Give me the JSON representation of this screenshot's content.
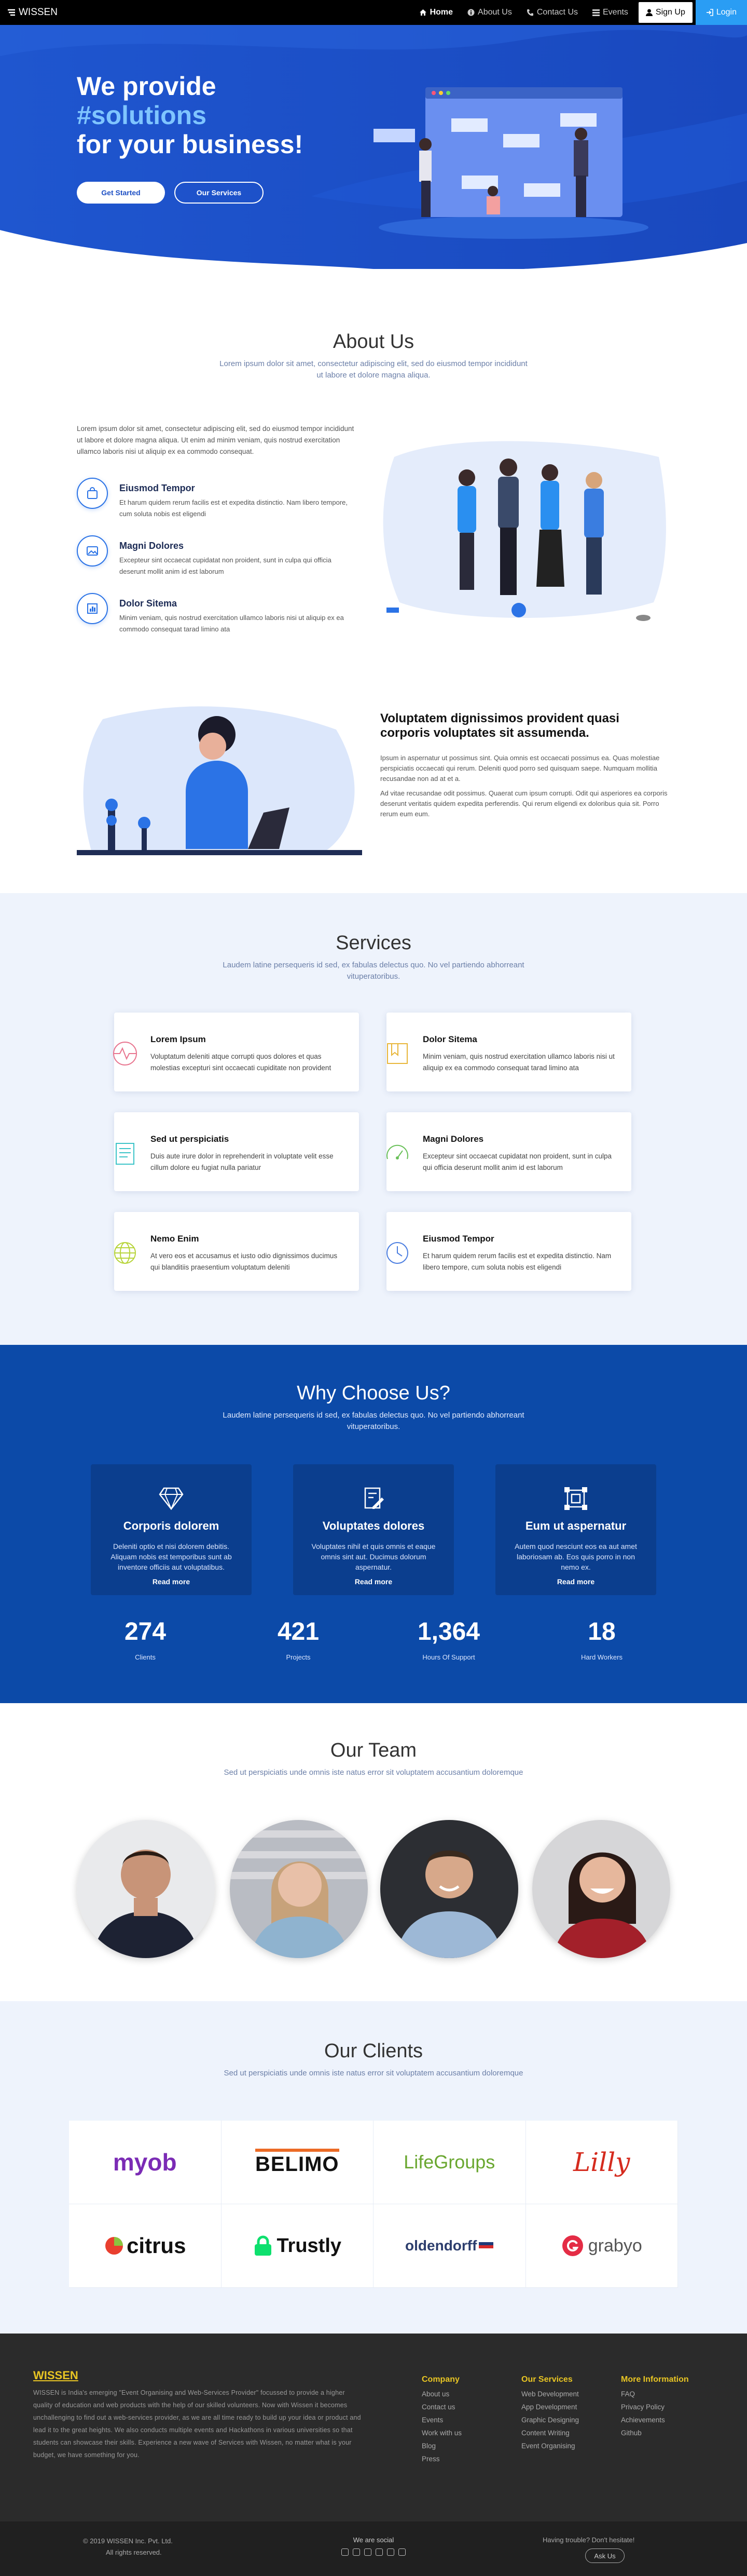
{
  "nav": {
    "brand": "WISSEN",
    "links": [
      {
        "label": "Home",
        "icon": "home-icon"
      },
      {
        "label": "About Us",
        "icon": "info-icon"
      },
      {
        "label": "Contact Us",
        "icon": "phone-icon"
      },
      {
        "label": "Events",
        "icon": "list-icon"
      },
      {
        "label": "Sign Up",
        "icon": "user-icon"
      },
      {
        "label": "Login",
        "icon": "login-icon"
      }
    ]
  },
  "hero": {
    "line1": "We provide",
    "line2": "#solutions",
    "line3": "for your business!",
    "primary_button": "Get Started",
    "secondary_button": "Our Services"
  },
  "about": {
    "title": "About Us",
    "subtitle": "Lorem ipsum dolor sit amet, consectetur adipiscing elit, sed do eiusmod tempor incididunt ut labore et dolore magna aliqua.",
    "intro": "Lorem ipsum dolor sit amet, consectetur adipiscing elit, sed do eiusmod tempor incididunt ut labore et dolore magna aliqua. Ut enim ad minim veniam, quis nostrud exercitation ullamco laboris nisi ut aliquip ex ea commodo consequat.",
    "features": [
      {
        "title": "Eiusmod Tempor",
        "text": "Et harum quidem rerum facilis est et expedita distinctio. Nam libero tempore, cum soluta nobis est eligendi",
        "icon": "shopping-bag-icon"
      },
      {
        "title": "Magni Dolores",
        "text": "Excepteur sint occaecat cupidatat non proident, sunt in culpa qui officia deserunt mollit anim id est laborum",
        "icon": "image-icon"
      },
      {
        "title": "Dolor Sitema",
        "text": "Minim veniam, quis nostrud exercitation ullamco laboris nisi ut aliquip ex ea commodo consequat tarad limino ata",
        "icon": "bar-chart-icon"
      }
    ],
    "block2_title": "Voluptatem dignissimos provident quasi corporis voluptates sit assumenda.",
    "block2_p1": "Ipsum in aspernatur ut possimus sint. Quia omnis est occaecati possimus ea. Quas molestiae perspiciatis occaecati qui rerum. Deleniti quod porro sed quisquam saepe. Numquam mollitia recusandae non ad at et a.",
    "block2_p2": "Ad vitae recusandae odit possimus. Quaerat cum ipsum corrupti. Odit qui asperiores ea corporis deserunt veritatis quidem expedita perferendis. Qui rerum eligendi ex doloribus quia sit. Porro rerum eum eum."
  },
  "services": {
    "title": "Services",
    "subtitle": "Laudem latine persequeris id sed, ex fabulas delectus quo. No vel partiendo abhorreant vituperatoribus.",
    "items": [
      {
        "title": "Lorem Ipsum",
        "text": "Voluptatum deleniti atque corrupti quos dolores et quas molestias excepturi sint occaecati cupiditate non provident",
        "icon": "activity-icon",
        "color": "#e8758f"
      },
      {
        "title": "Dolor Sitema",
        "text": "Minim veniam, quis nostrud exercitation ullamco laboris nisi ut aliquip ex ea commodo consequat tarad limino ata",
        "icon": "bookmark-icon",
        "color": "#e8b63a"
      },
      {
        "title": "Sed ut perspiciatis",
        "text": "Duis aute irure dolor in reprehenderit in voluptate velit esse cillum dolore eu fugiat nulla pariatur",
        "icon": "document-icon",
        "color": "#3cc4c8"
      },
      {
        "title": "Magni Dolores",
        "text": "Excepteur sint occaecat cupidatat non proident, sunt in culpa qui officia deserunt mollit anim id est laborum",
        "icon": "speedometer-icon",
        "color": "#69c058"
      },
      {
        "title": "Nemo Enim",
        "text": "At vero eos et accusamus et iusto odio dignissimos ducimus qui blanditiis praesentium voluptatum deleniti",
        "icon": "globe-icon",
        "color": "#b7d43a"
      },
      {
        "title": "Eiusmod Tempor",
        "text": "Et harum quidem rerum facilis est et expedita distinctio. Nam libero tempore, cum soluta nobis est eligendi",
        "icon": "clock-icon",
        "color": "#4a7de0"
      }
    ]
  },
  "why": {
    "title": "Why Choose Us?",
    "subtitle": "Laudem latine persequeris id sed, ex fabulas delectus quo. No vel partiendo abhorreant vituperatoribus.",
    "cards": [
      {
        "title": "Corporis dolorem",
        "text": "Deleniti optio et nisi dolorem debitis. Aliquam nobis est temporibus sunt ab inventore officiis aut voluptatibus.",
        "link": "Read more",
        "icon": "diamond-icon"
      },
      {
        "title": "Voluptates dolores",
        "text": "Voluptates nihil et quis omnis et eaque omnis sint aut. Ducimus dolorum aspernatur.",
        "link": "Read more",
        "icon": "document-edit-icon"
      },
      {
        "title": "Eum ut aspernatur",
        "text": "Autem quod nesciunt eos ea aut amet laboriosam ab. Eos quis porro in non nemo ex.",
        "link": "Read more",
        "icon": "frame-icon"
      }
    ],
    "stats": [
      {
        "value": "274",
        "label": "Clients"
      },
      {
        "value": "421",
        "label": "Projects"
      },
      {
        "value": "1,364",
        "label": "Hours Of Support"
      },
      {
        "value": "18",
        "label": "Hard Workers"
      }
    ]
  },
  "team": {
    "title": "Our Team",
    "subtitle": "Sed ut perspiciatis unde omnis iste natus error sit voluptatem accusantium doloremque"
  },
  "clients": {
    "title": "Our Clients",
    "subtitle": "Sed ut perspiciatis unde omnis iste natus error sit voluptatem accusantium doloremque",
    "logos": [
      "myob",
      "BELIMO",
      "LifeGroups",
      "Lilly",
      "citrus",
      "Trustly",
      "oldendorff",
      "grabyo"
    ]
  },
  "footer": {
    "brand": "WISSEN",
    "about": "WISSEN is India's emerging \"Event Organising and Web-Services Provider\" focussed to provide a higher quality of education and web products with the help of our skilled volunteers. Now with Wissen it becomes unchallenging to find out a web-services provider, as we are all time ready to build up your idea or product and lead it to the great heights. We also conducts multiple events and Hackathons in various universities so that students can showcase their skills. Experience a new wave of Services with Wissen, no matter what is your budget, we have something for you.",
    "col1_title": "Company",
    "col1": [
      "About us",
      "Contact us",
      "Events",
      "Work with us",
      "Blog",
      "Press"
    ],
    "col2_title": "Our Services",
    "col2": [
      "Web Development",
      "App Development",
      "Graphic Designing",
      "Content Writing",
      "Event Organising"
    ],
    "col3_title": "More Information",
    "col3": [
      "FAQ",
      "Privacy Policy",
      "Achievements",
      "Github"
    ],
    "copyright": "© 2019 WISSEN Inc. Pvt. Ltd.",
    "rights": "All rights reserved.",
    "social_title": "We are social",
    "help_text": "Having trouble? Don't hesitate!",
    "ask_button": "Ask Us"
  }
}
